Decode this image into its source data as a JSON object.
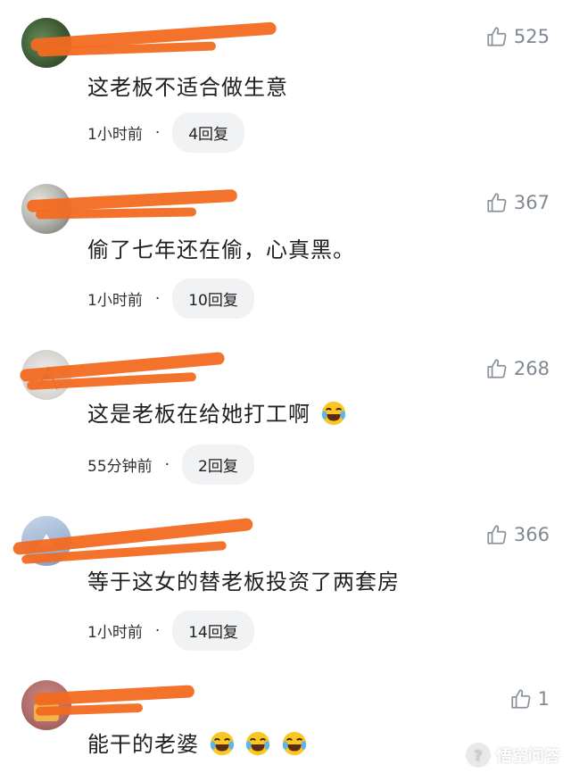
{
  "comments": [
    {
      "name": "",
      "likes": "525",
      "text": "这老板不适合做生意",
      "time": "1小时前",
      "separator": "·",
      "reply": "4回复"
    },
    {
      "name": "",
      "likes": "367",
      "text": "偷了七年还在偷，心真黑。",
      "time": "1小时前",
      "separator": "·",
      "reply": "10回复"
    },
    {
      "name": "",
      "likes": "268",
      "text": "这是老板在给她打工啊",
      "time": "55分钟前",
      "separator": "·",
      "reply": "2回复"
    },
    {
      "name": "",
      "likes": "366",
      "text": "等于这女的替老板投资了两套房",
      "time": "1小时前",
      "separator": "·",
      "reply": "14回复"
    },
    {
      "name": "",
      "likes": "1",
      "text": "能干的老婆"
    }
  ],
  "watermark": {
    "text": "悟空问答"
  },
  "colors": {
    "redaction": "#f26a21",
    "like_icon": "#7f8893",
    "reply_bg": "#f1f2f4"
  },
  "icons": {
    "like": "thumbs-up-icon",
    "emoji": "laughing-crying-emoji"
  }
}
